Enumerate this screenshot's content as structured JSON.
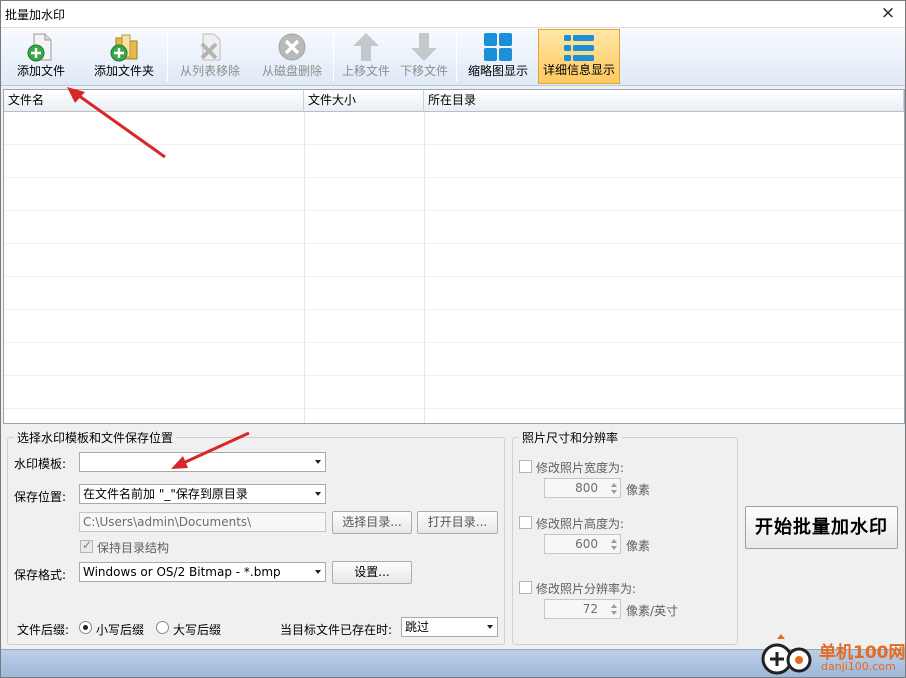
{
  "window": {
    "title": "批量加水印",
    "close_glyph": "×"
  },
  "toolbar": [
    {
      "name": "add-file-button",
      "icon": "add-file-icon",
      "label": "添加文件",
      "enabled": true
    },
    {
      "name": "add-folder-button",
      "icon": "add-folder-icon",
      "label": "添加文件夹",
      "enabled": true
    },
    {
      "name": "remove-from-list-button",
      "icon": "remove-from-list-icon",
      "label": "从列表移除",
      "enabled": false
    },
    {
      "name": "delete-from-disk-button",
      "icon": "delete-from-disk-icon",
      "label": "从磁盘删除",
      "enabled": false
    },
    {
      "name": "move-up-button",
      "icon": "arrow-up-icon",
      "label": "上移文件",
      "enabled": false
    },
    {
      "name": "move-down-button",
      "icon": "arrow-down-icon",
      "label": "下移文件",
      "enabled": false
    },
    {
      "name": "thumbnail-view-button",
      "icon": "thumbnail-grid-icon",
      "label": "缩略图显示",
      "enabled": true
    },
    {
      "name": "detail-view-button",
      "icon": "detail-list-icon",
      "label": "详细信息显示",
      "enabled": true,
      "active": true
    }
  ],
  "file_table": {
    "columns": [
      "文件名",
      "文件大小",
      "所在目录"
    ],
    "rows": []
  },
  "settings": {
    "group_title": "选择水印模板和文件保存位置",
    "template_label": "水印模板:",
    "template_value": "",
    "save_location_label": "保存位置:",
    "save_location_value": "在文件名前加 \"_\"保存到原目录",
    "path_value": "C:\\Users\\admin\\Documents\\",
    "choose_dir_button": "选择目录...",
    "open_dir_button": "打开目录...",
    "keep_structure_label": "保持目录结构",
    "keep_structure_checked": true,
    "save_format_label": "保存格式:",
    "save_format_value": "Windows or OS/2 Bitmap - *.bmp",
    "settings_button": "设置...",
    "suffix_label": "文件后缀:",
    "suffix_lower": "小写后缀",
    "suffix_upper": "大写后缀",
    "suffix_selected": "lower",
    "exists_label": "当目标文件已存在时:",
    "exists_value": "跳过"
  },
  "photo": {
    "group_title": "照片尺寸和分辨率",
    "width_label": "修改照片宽度为:",
    "width_value": "800",
    "width_unit": "像素",
    "height_label": "修改照片高度为:",
    "height_value": "600",
    "height_unit": "像素",
    "res_label": "修改照片分辨率为:",
    "res_value": "72",
    "res_unit": "像素/英寸"
  },
  "start_button": "开始批量加水印",
  "watermark": {
    "site_name": "单机100网",
    "site_url": "danji100.com"
  },
  "colors": {
    "accent_active": "#ffc95f",
    "annotation_arrow": "#d9262a",
    "watermark": "#e56a1e"
  }
}
